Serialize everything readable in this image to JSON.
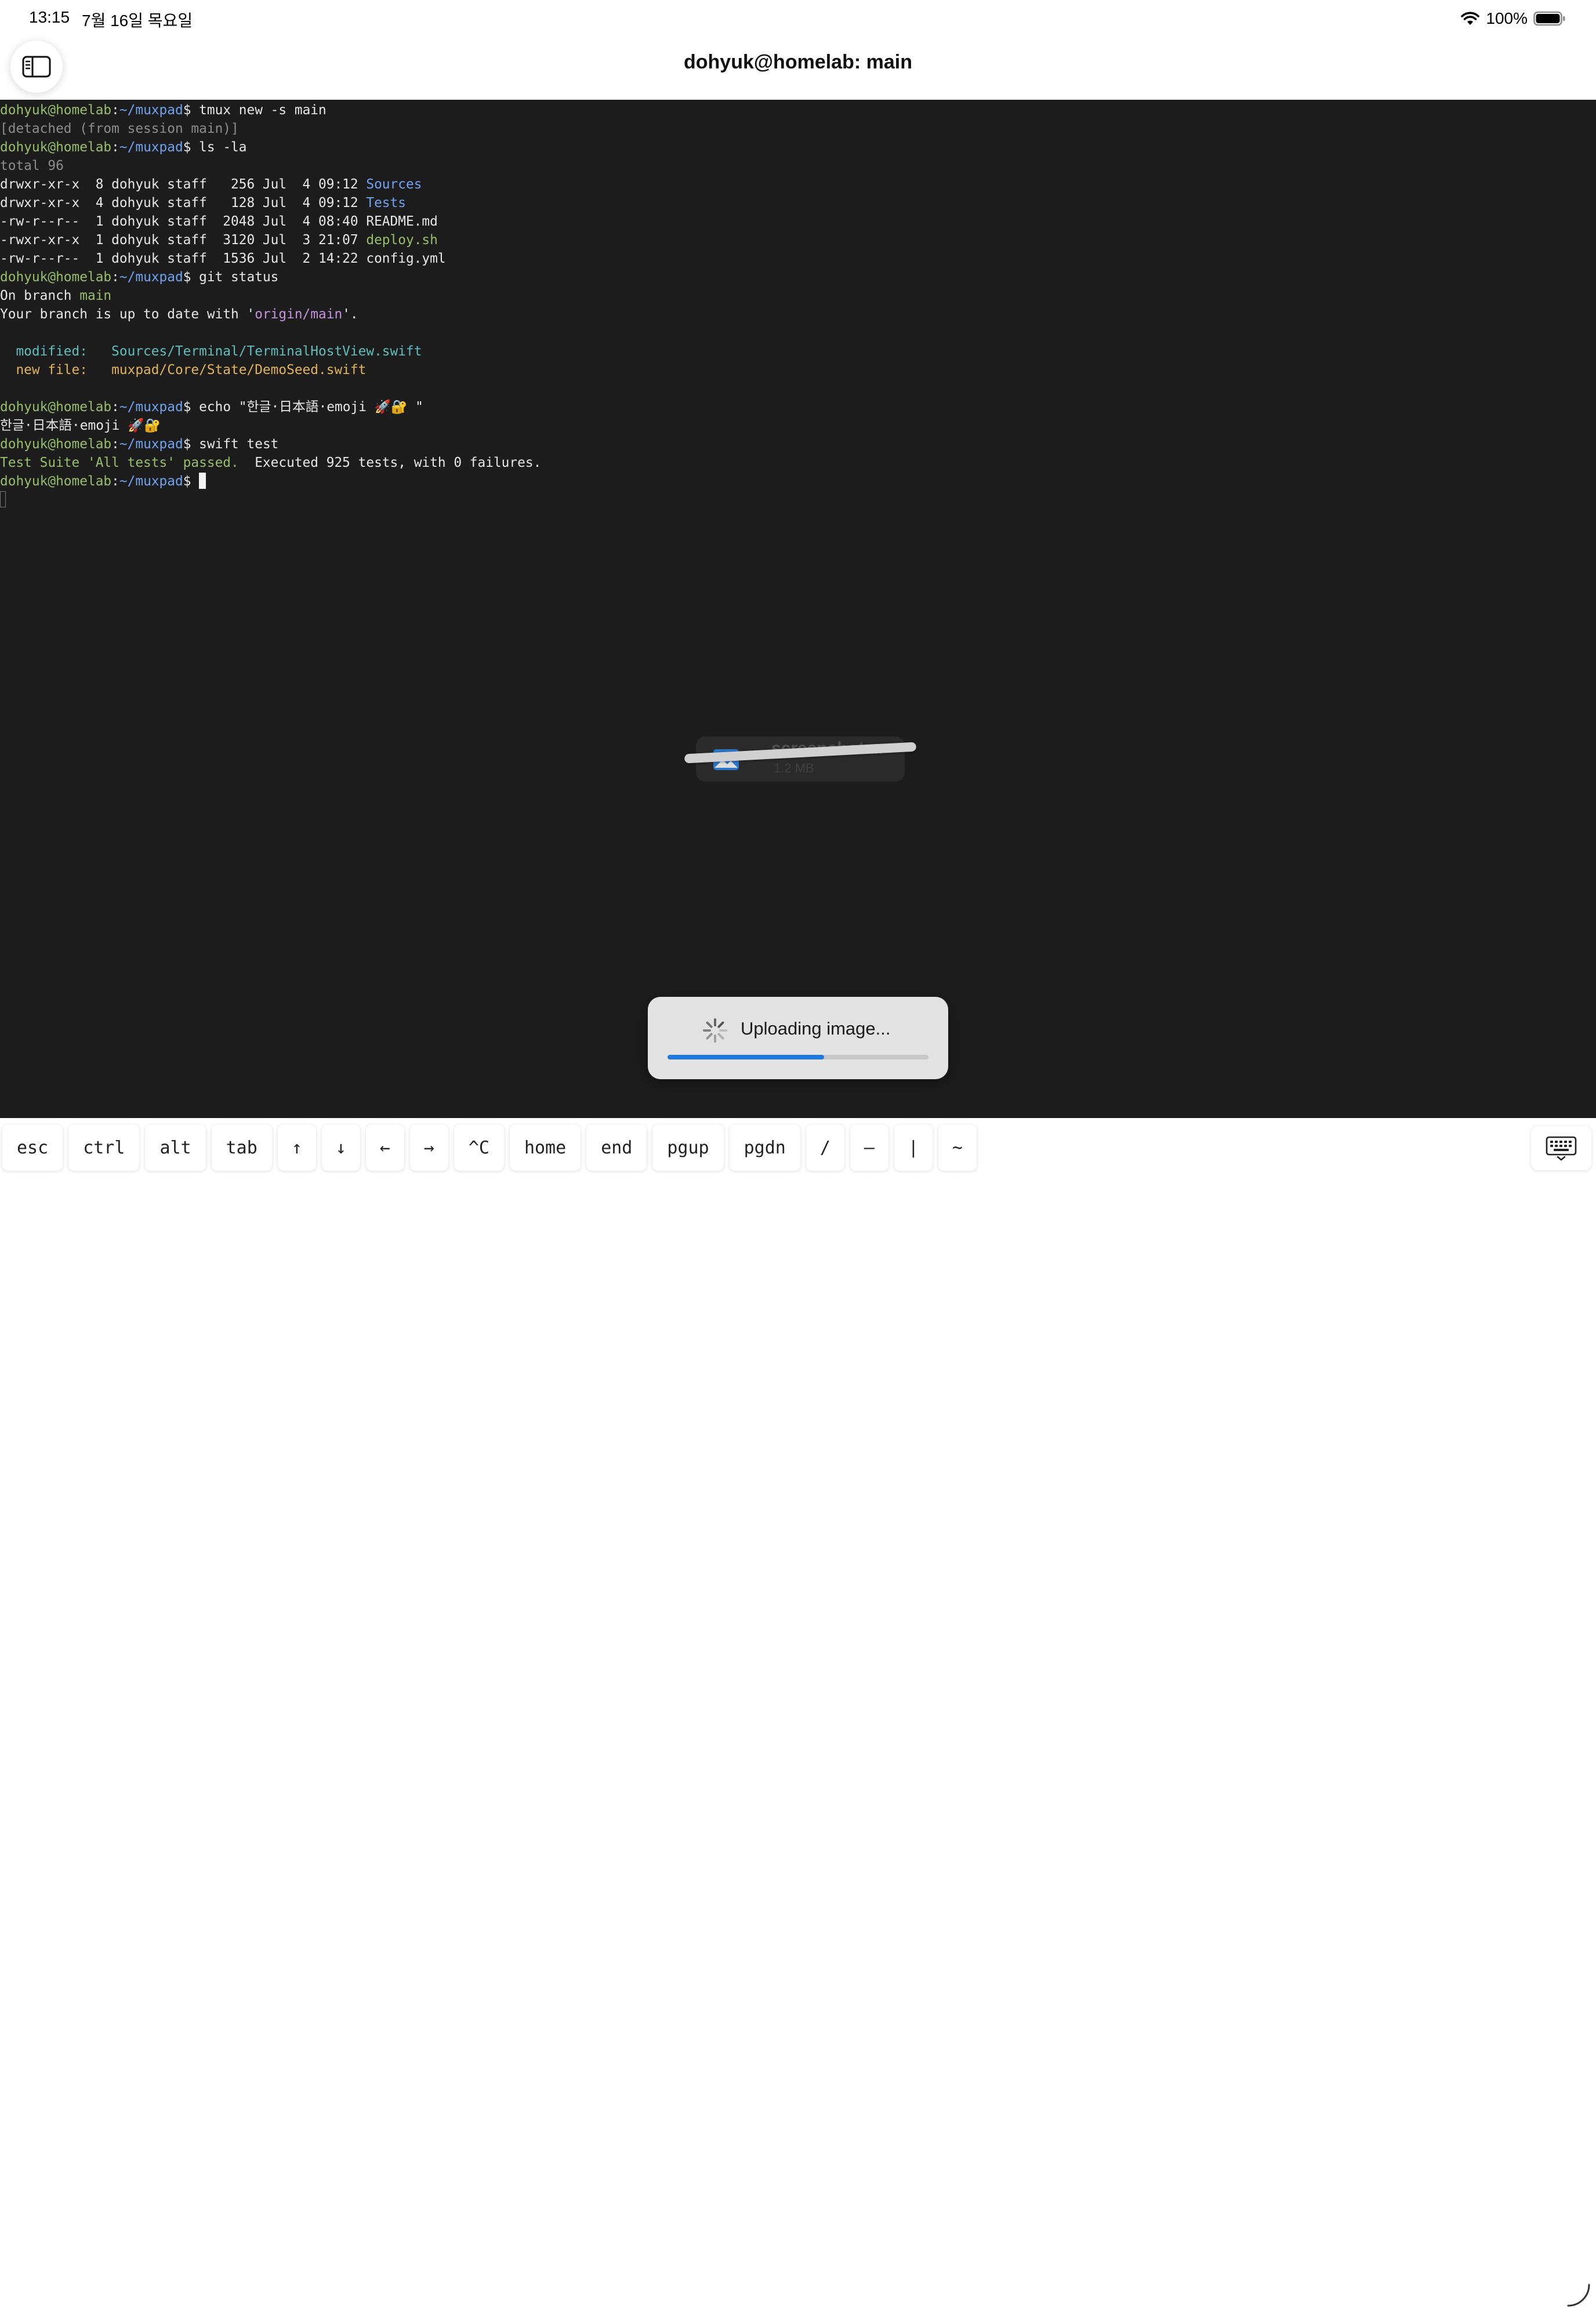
{
  "status_bar": {
    "time": "13:15",
    "date": "7월 16일 목요일",
    "battery": "100%"
  },
  "title_bar": {
    "title": "dohyuk@homelab: main",
    "sidebar_icon": "sidebar-icon"
  },
  "terminal": {
    "lines": [
      [
        {
          "t": "dohyuk@homelab",
          "c": "green"
        },
        {
          "t": ":"
        },
        {
          "t": "~/muxpad",
          "c": "blue"
        },
        {
          "t": "$ tmux new -s main"
        }
      ],
      [
        {
          "t": "[detached (from session main)]",
          "c": "gray"
        }
      ],
      [
        {
          "t": "dohyuk@homelab",
          "c": "green"
        },
        {
          "t": ":"
        },
        {
          "t": "~/muxpad",
          "c": "blue"
        },
        {
          "t": "$ ls -la"
        }
      ],
      [
        {
          "t": "total 96",
          "c": "gray"
        }
      ],
      [
        {
          "t": "drwxr-xr-x  8 dohyuk staff   256 Jul  4 09:12 "
        },
        {
          "t": "Sources",
          "c": "blue"
        }
      ],
      [
        {
          "t": "drwxr-xr-x  4 dohyuk staff   128 Jul  4 09:12 "
        },
        {
          "t": "Tests",
          "c": "blue"
        }
      ],
      [
        {
          "t": "-rw-r--r--  1 dohyuk staff  2048 Jul  4 08:40 README.md"
        }
      ],
      [
        {
          "t": "-rwxr-xr-x  1 dohyuk staff  3120 Jul  3 21:07 "
        },
        {
          "t": "deploy.sh",
          "c": "green"
        }
      ],
      [
        {
          "t": "-rw-r--r--  1 dohyuk staff  1536 Jul  2 14:22 config.yml"
        }
      ],
      [
        {
          "t": "dohyuk@homelab",
          "c": "green"
        },
        {
          "t": ":"
        },
        {
          "t": "~/muxpad",
          "c": "blue"
        },
        {
          "t": "$ git status"
        }
      ],
      [
        {
          "t": "On branch "
        },
        {
          "t": "main",
          "c": "green"
        }
      ],
      [
        {
          "t": "Your branch is up to date with '"
        },
        {
          "t": "origin/main",
          "c": "purple"
        },
        {
          "t": "'."
        }
      ],
      [],
      [
        {
          "t": "  modified:   Sources/Terminal/TerminalHostView.swift",
          "c": "cyan"
        }
      ],
      [
        {
          "t": "  new file:   muxpad/Core/State/DemoSeed.swift",
          "c": "orange"
        }
      ],
      [],
      [
        {
          "t": "dohyuk@homelab",
          "c": "green"
        },
        {
          "t": ":"
        },
        {
          "t": "~/muxpad",
          "c": "blue"
        },
        {
          "t": "$ echo \"한글·日本語·emoji 🚀🔐 \""
        }
      ],
      [
        {
          "t": "한글·日本語·emoji 🚀🔐"
        }
      ],
      [
        {
          "t": "dohyuk@homelab",
          "c": "green"
        },
        {
          "t": ":"
        },
        {
          "t": "~/muxpad",
          "c": "blue"
        },
        {
          "t": "$ swift test"
        }
      ],
      [
        {
          "t": "Test Suite 'All tests' passed.",
          "c": "green"
        },
        {
          "t": "  Executed 925 tests, with 0 failures."
        }
      ],
      [
        {
          "t": "dohyuk@homelab",
          "c": "green"
        },
        {
          "t": ":"
        },
        {
          "t": "~/muxpad",
          "c": "blue"
        },
        {
          "t": "$ "
        },
        {
          "cursor": "block"
        }
      ],
      [
        {
          "cursor": "ghost"
        }
      ]
    ]
  },
  "drag_preview": {
    "file_name": "screenshot....",
    "file_size": "1.2 MB",
    "icon": "image-icon"
  },
  "upload_toast": {
    "label": "Uploading image...",
    "progress": 0.6,
    "accent": "#1f7ae0"
  },
  "key_bar": {
    "keys": [
      "esc",
      "ctrl",
      "alt",
      "tab",
      "↑",
      "↓",
      "←",
      "→",
      "^C",
      "home",
      "end",
      "pgup",
      "pgdn",
      "/",
      "–",
      "|",
      "~"
    ],
    "keyboard_icon": "keyboard-icon"
  }
}
